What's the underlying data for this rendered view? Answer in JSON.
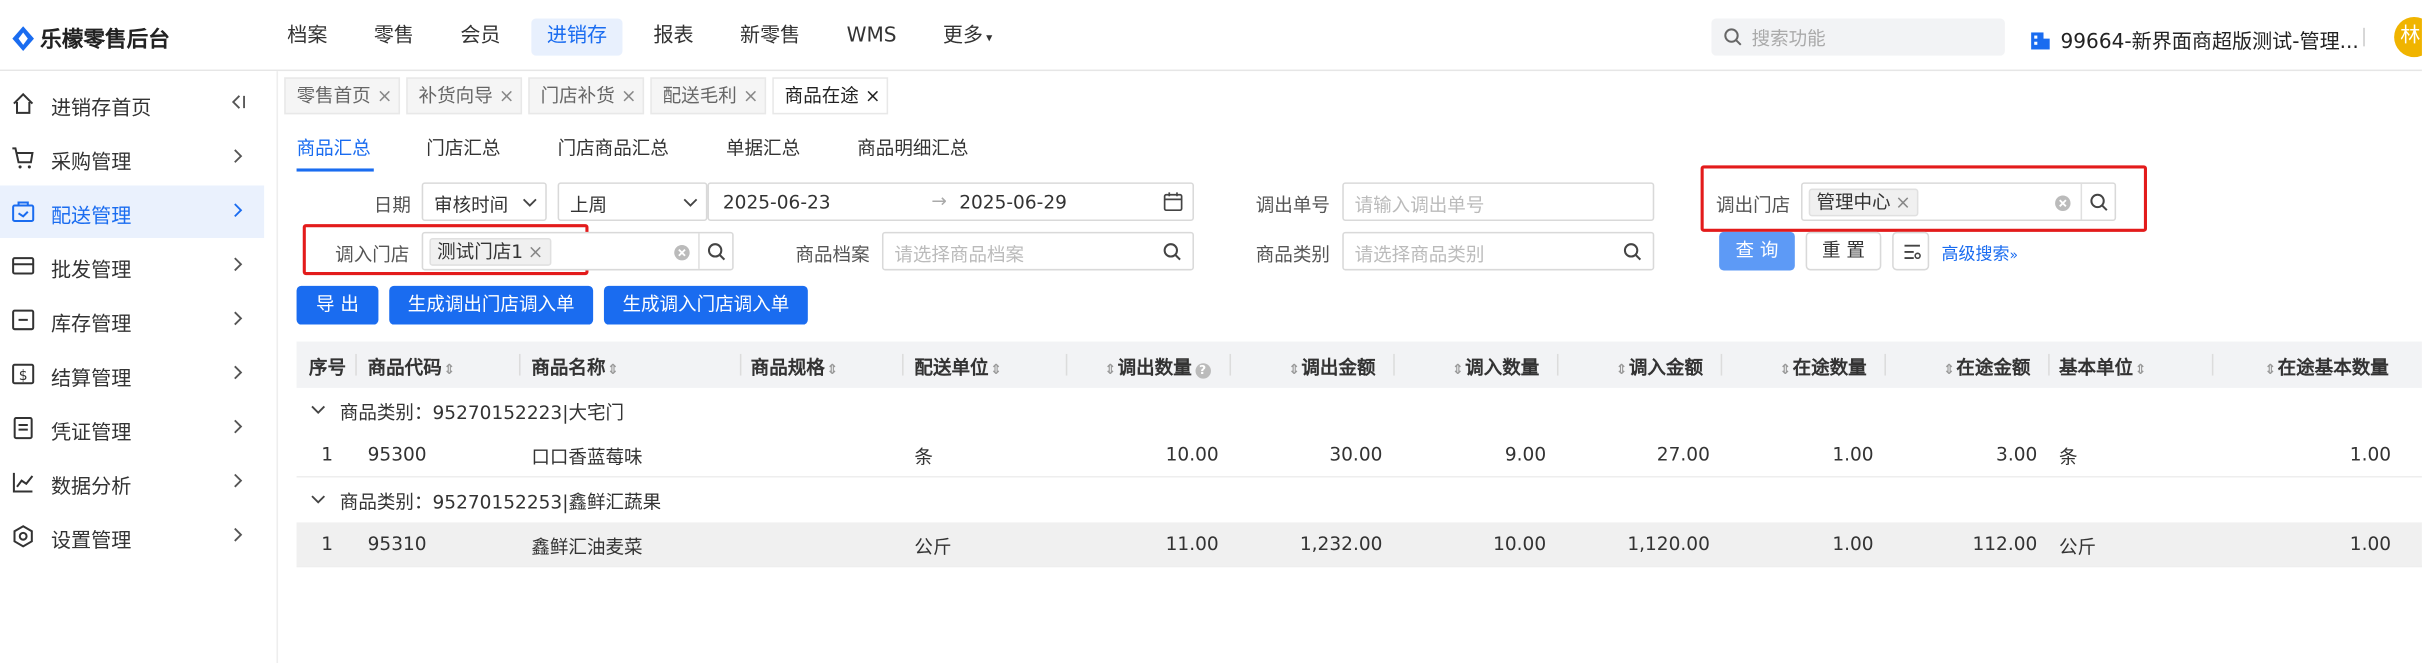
{
  "app": {
    "title": "乐檬零售后台"
  },
  "topnav": [
    "档案",
    "零售",
    "会员",
    "进销存",
    "报表",
    "新零售",
    "WMS",
    "更多"
  ],
  "search": {
    "placeholder": "搜索功能"
  },
  "store": "99664-新界面商超版测试-管理...",
  "avatar": "林",
  "sidebar": [
    {
      "label": "进销存首页",
      "icon": "home-icon"
    },
    {
      "label": "采购管理",
      "icon": "cart-icon"
    },
    {
      "label": "配送管理",
      "icon": "delivery-icon"
    },
    {
      "label": "批发管理",
      "icon": "wallet-icon"
    },
    {
      "label": "库存管理",
      "icon": "inventory-icon"
    },
    {
      "label": "结算管理",
      "icon": "money-icon"
    },
    {
      "label": "凭证管理",
      "icon": "voucher-icon"
    },
    {
      "label": "数据分析",
      "icon": "chart-icon"
    },
    {
      "label": "设置管理",
      "icon": "settings-icon"
    }
  ],
  "tabs": [
    {
      "label": "零售首页"
    },
    {
      "label": "补货向导"
    },
    {
      "label": "门店补货"
    },
    {
      "label": "配送毛利"
    },
    {
      "label": "商品在途"
    }
  ],
  "subtabs": [
    "商品汇总",
    "门店汇总",
    "门店商品汇总",
    "单据汇总",
    "商品明细汇总"
  ],
  "filters": {
    "date_label": "日期",
    "date_type": "审核时间",
    "period": "上周",
    "date_from": "2025-06-23",
    "date_to": "2025-06-29",
    "out_order_label": "调出单号",
    "out_order_placeholder": "请输入调出单号",
    "out_store_label": "调出门店",
    "out_store_tag": "管理中心",
    "in_store_label": "调入门店",
    "in_store_tag": "测试门店1",
    "product_label": "商品档案",
    "product_placeholder": "请选择商品档案",
    "category_label": "商品类别",
    "category_placeholder": "请选择商品类别",
    "query": "查 询",
    "reset": "重 置",
    "advanced": "高级搜索"
  },
  "actions": {
    "export": "导 出",
    "gen_out": "生成调出门店调入单",
    "gen_in": "生成调入门店调入单"
  },
  "table": {
    "columns": [
      "序号",
      "商品代码",
      "商品名称",
      "商品规格",
      "配送单位",
      "调出数量",
      "调出金额",
      "调入数量",
      "调入金额",
      "在途数量",
      "在途金额",
      "基本单位",
      "在途基本数量"
    ],
    "groups": [
      {
        "label": "商品类别：95270152223|大宅门",
        "rows": [
          {
            "idx": "1",
            "code": "95300",
            "name": "口口香蓝莓味",
            "spec": "",
            "unit": "条",
            "out_qty": "10.00",
            "out_amt": "30.00",
            "in_qty": "9.00",
            "in_amt": "27.00",
            "transit_qty": "1.00",
            "transit_amt": "3.00",
            "base_unit": "条",
            "transit_base": "1.00"
          }
        ]
      },
      {
        "label": "商品类别：95270152253|鑫鲜汇蔬果",
        "rows": [
          {
            "idx": "1",
            "code": "95310",
            "name": "鑫鲜汇油麦菜",
            "spec": "",
            "unit": "公斤",
            "out_qty": "11.00",
            "out_amt": "1,232.00",
            "in_qty": "10.00",
            "in_amt": "1,120.00",
            "transit_qty": "1.00",
            "transit_amt": "112.00",
            "base_unit": "公斤",
            "transit_base": "1.00"
          }
        ]
      }
    ]
  },
  "colors": {
    "primary": "#1a6cf0",
    "highlight_border": "#e31b1b"
  }
}
